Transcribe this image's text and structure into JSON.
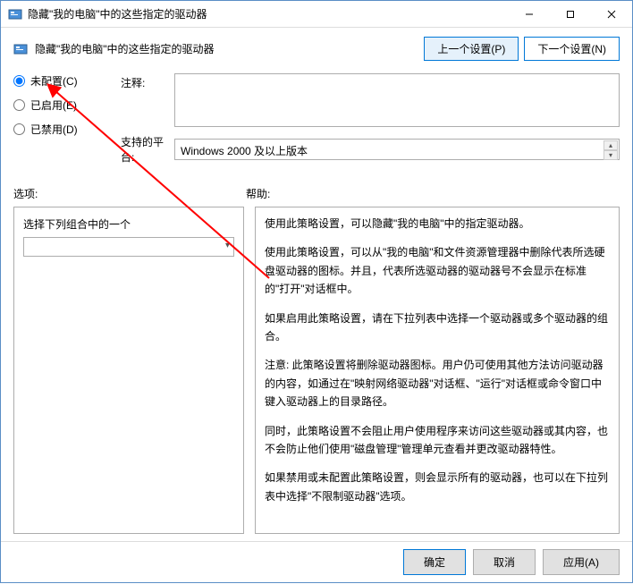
{
  "window": {
    "title": "隐藏\"我的电脑\"中的这些指定的驱动器"
  },
  "header": {
    "title": "隐藏\"我的电脑\"中的这些指定的驱动器",
    "prev": "上一个设置(P)",
    "next": "下一个设置(N)"
  },
  "radios": {
    "not_configured": "未配置(C)",
    "enabled": "已启用(E)",
    "disabled": "已禁用(D)"
  },
  "fields": {
    "comment_label": "注释:",
    "platform_label": "支持的平台:",
    "platform_value": "Windows 2000 及以上版本"
  },
  "sections": {
    "options": "选项:",
    "help": "帮助:"
  },
  "options": {
    "select_label": "选择下列组合中的一个"
  },
  "help": {
    "p1": "使用此策略设置，可以隐藏\"我的电脑\"中的指定驱动器。",
    "p2": "使用此策略设置，可以从\"我的电脑\"和文件资源管理器中删除代表所选硬盘驱动器的图标。并且，代表所选驱动器的驱动器号不会显示在标准的\"打开\"对话框中。",
    "p3": "如果启用此策略设置，请在下拉列表中选择一个驱动器或多个驱动器的组合。",
    "p4": "注意: 此策略设置将删除驱动器图标。用户仍可使用其他方法访问驱动器的内容，如通过在\"映射网络驱动器\"对话框、\"运行\"对话框或命令窗口中键入驱动器上的目录路径。",
    "p5": "同时，此策略设置不会阻止用户使用程序来访问这些驱动器或其内容，也不会防止他们使用\"磁盘管理\"管理单元查看并更改驱动器特性。",
    "p6": "如果禁用或未配置此策略设置，则会显示所有的驱动器，也可以在下拉列表中选择\"不限制驱动器\"选项。"
  },
  "footer": {
    "ok": "确定",
    "cancel": "取消",
    "apply": "应用(A)"
  }
}
